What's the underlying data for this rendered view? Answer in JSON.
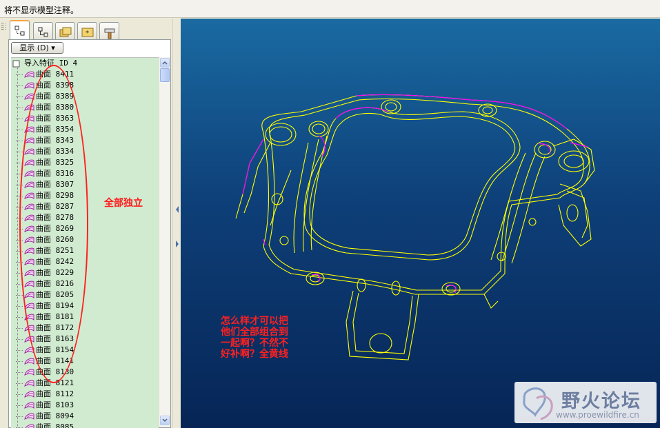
{
  "status_bar": {
    "message": "将不显示模型注释。"
  },
  "model_tree": {
    "tabs": [
      {
        "icon": "model-tree-icon",
        "active": true
      },
      {
        "icon": "layer-tree-icon",
        "active": false
      },
      {
        "icon": "folder-browser-icon",
        "active": false
      },
      {
        "icon": "favorites-icon",
        "active": false
      },
      {
        "icon": "connections-icon",
        "active": false
      }
    ],
    "show_button": "显示 (D) ▾",
    "root": "导入特征 ID 4",
    "items": [
      "曲面 8411",
      "曲面 8398",
      "曲面 8389",
      "曲面 8380",
      "曲面 8363",
      "曲面 8354",
      "曲面 8343",
      "曲面 8334",
      "曲面 8325",
      "曲面 8316",
      "曲面 8307",
      "曲面 8298",
      "曲面 8287",
      "曲面 8278",
      "曲面 8269",
      "曲面 8260",
      "曲面 8251",
      "曲面 8242",
      "曲面 8229",
      "曲面 8216",
      "曲面 8205",
      "曲面 8194",
      "曲面 8181",
      "曲面 8172",
      "曲面 8163",
      "曲面 8154",
      "曲面 8141",
      "曲面 8130",
      "曲面 8121",
      "曲面 8112",
      "曲面 8103",
      "曲面 8094",
      "曲面 8085"
    ]
  },
  "annotations": {
    "all_independent": "全部独立",
    "question_lines": [
      "怎么样才可以把",
      "他们全部组合到",
      "一起啊？不然不",
      "好补啊？全黄线"
    ]
  },
  "watermark": {
    "name": "野火论坛",
    "url": "www.proewildfire.cn"
  },
  "colors": {
    "tree_bg": "#d1ebd1",
    "wireframe": "#ffff00",
    "edge_highlight": "#ff00ff",
    "annotation": "#ff2020"
  }
}
